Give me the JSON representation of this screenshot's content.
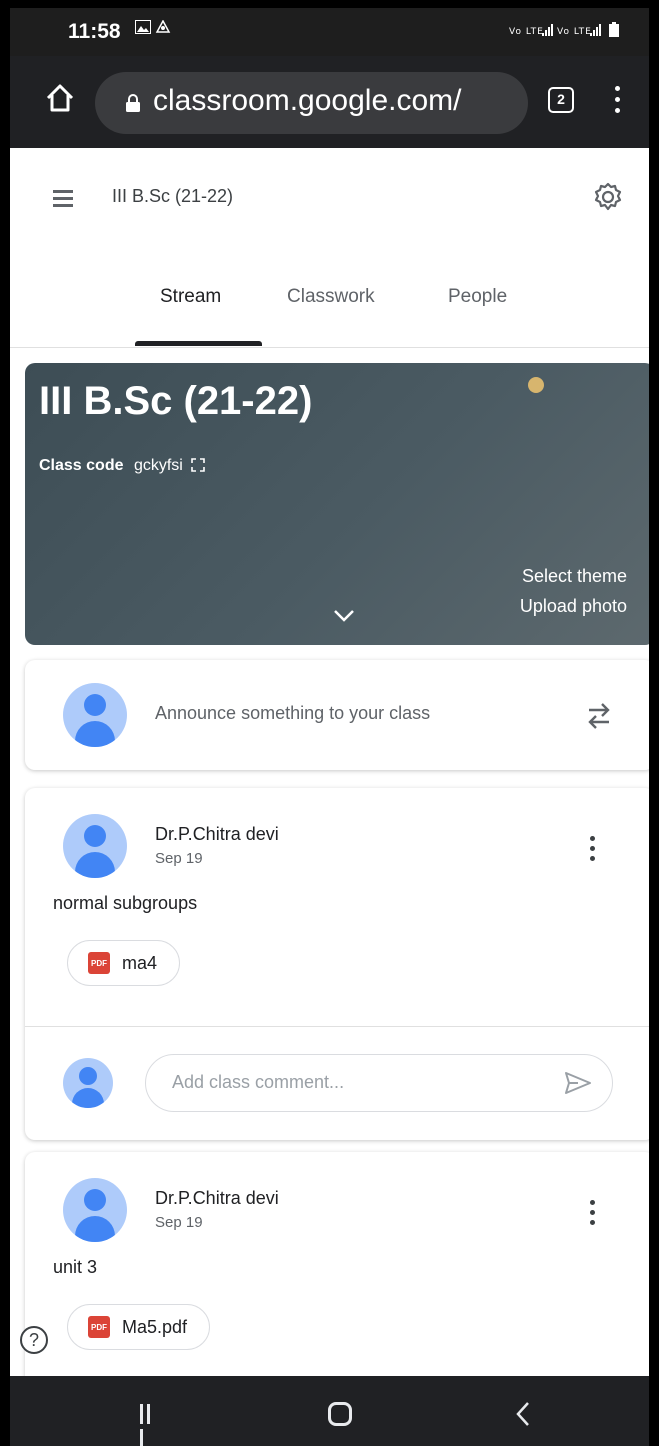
{
  "status_bar": {
    "time": "11:58",
    "left_icons": "gallery-icon, airplay-icon",
    "right_icons": "VoLTE LTE2 signal VoLTE signal battery"
  },
  "browser": {
    "url": "classroom.google.com/",
    "tab_count": "2",
    "icons": [
      "home-icon",
      "lock-icon",
      "tabs-icon",
      "menu-icon"
    ]
  },
  "header": {
    "title": "III B.Sc (21-22)"
  },
  "tabs": [
    {
      "label": "Stream",
      "active": true
    },
    {
      "label": "Classwork",
      "active": false
    },
    {
      "label": "People",
      "active": false
    }
  ],
  "banner": {
    "title": "III B.Sc (21-22)",
    "class_code_label": "Class code",
    "class_code": "gckyfsi",
    "select_theme": "Select theme",
    "upload_photo": "Upload photo",
    "background_color": "#46565e"
  },
  "announce": {
    "placeholder": "Announce something to your class"
  },
  "posts": [
    {
      "author": "Dr.P.Chitra devi",
      "date": "Sep 19",
      "body": "normal subgroups",
      "attachment": "ma4",
      "comment_placeholder": "Add class comment..."
    },
    {
      "author": "Dr.P.Chitra devi",
      "date": "Sep 19",
      "body": "unit 3",
      "attachment": "Ma5.pdf"
    }
  ],
  "help": "?",
  "colors": {
    "avatar_blue": "#4285f4",
    "avatar_light": "#aecbfa",
    "pdf_red": "#db4437"
  }
}
